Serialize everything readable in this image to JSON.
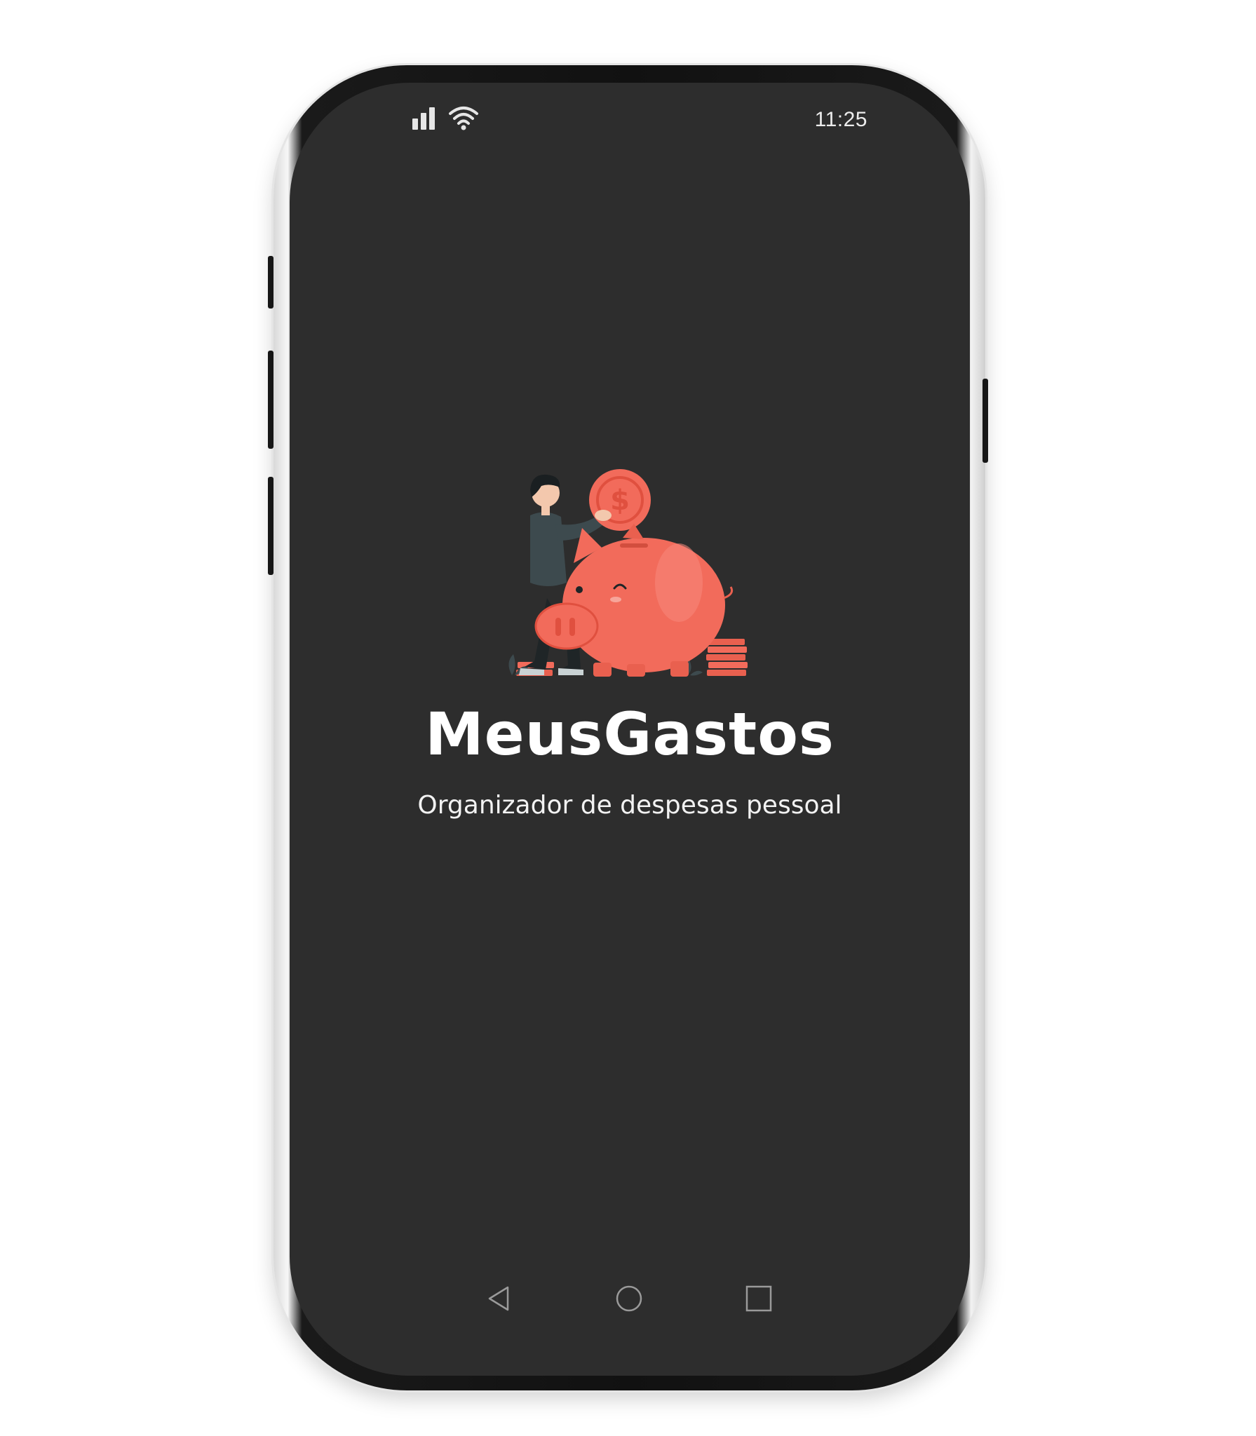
{
  "status_bar": {
    "time": "11:25",
    "icons": [
      "signal-icon",
      "wifi-icon"
    ]
  },
  "splash": {
    "app_title": "MeusGastos",
    "subtitle": "Organizador de despesas pessoal",
    "illustration": "piggy-bank-illustration"
  },
  "nav_bar": {
    "icons": [
      "back-icon",
      "home-icon",
      "recents-icon"
    ]
  },
  "colors": {
    "screen_background": "#2d2d2d",
    "accent": "#f26b5b",
    "text": "#ffffff"
  }
}
